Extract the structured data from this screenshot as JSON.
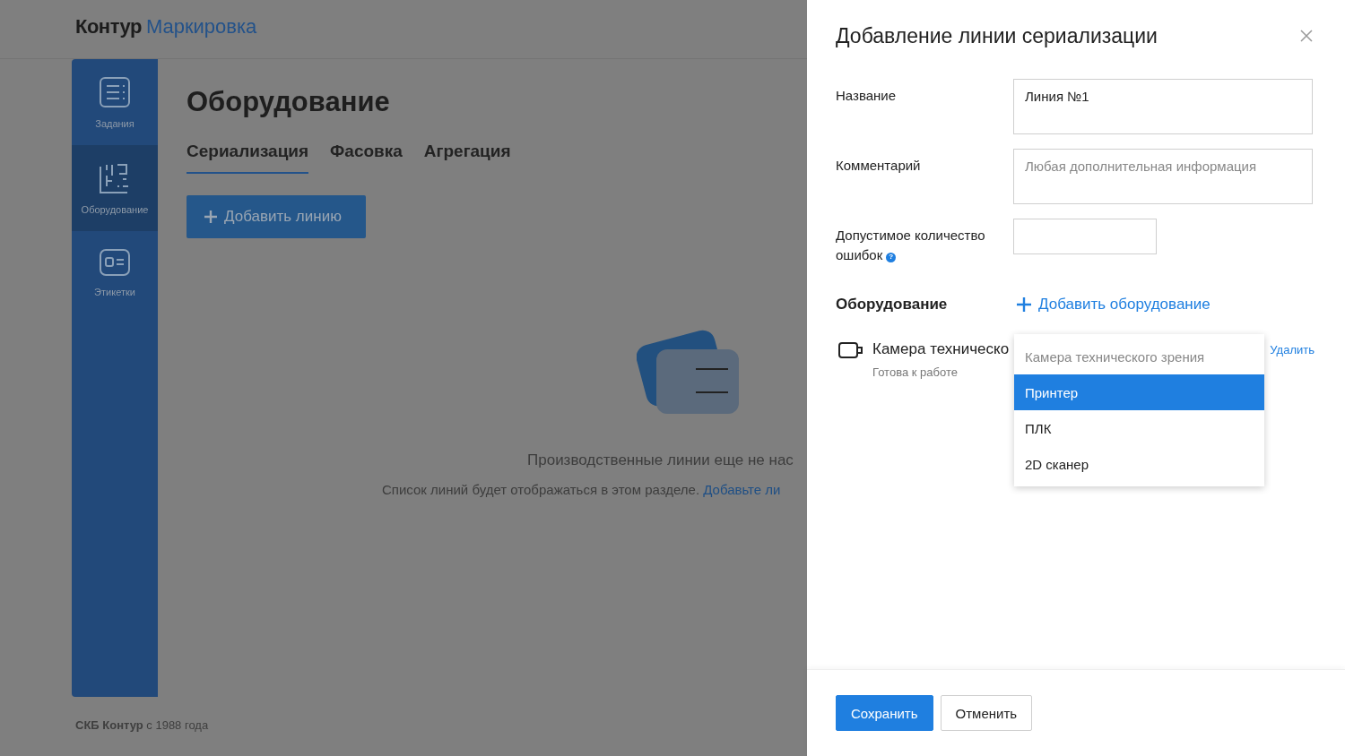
{
  "logo": {
    "brand": "Контур",
    "product": "Маркировка"
  },
  "sidebar": {
    "items": [
      {
        "label": "Задания",
        "kind": "tasks",
        "selected": false
      },
      {
        "label": "Оборудование",
        "kind": "equipment",
        "selected": true
      },
      {
        "label": "Этикетки",
        "kind": "labels",
        "selected": false
      }
    ]
  },
  "page": {
    "title": "Оборудование",
    "tabs": [
      {
        "label": "Сериализация",
        "selected": true
      },
      {
        "label": "Фасовка",
        "selected": false
      },
      {
        "label": "Агрегация",
        "selected": false
      }
    ],
    "add_button": "Добавить линию",
    "empty_state": {
      "heading": "Производственные линии еще не нас",
      "text": "Список линий будет отображаться в этом разделе.",
      "link": "Добавьте ли"
    }
  },
  "footer": "**СКБ Контур** с 1988 года",
  "drawer": {
    "title": "Добавление линии сериализации",
    "fields": [
      {
        "label": "Название",
        "value": "Линия №1",
        "kind": "textarea"
      },
      {
        "label": "Комментарий",
        "placeholder": "Любая дополнительная информация",
        "kind": "textarea"
      },
      {
        "label": "Допустимое количество ошибок",
        "help": "?",
        "kind": "short"
      }
    ],
    "equipment": {
      "label": "Оборудование",
      "add_link": "Добавить оборудование",
      "items": [
        {
          "name": "Камера техническо",
          "status": "Готова к работе",
          "remove": "Удалить"
        }
      ],
      "dropdown": [
        {
          "label": "Камера технического зрения",
          "disabled": true,
          "selected": false
        },
        {
          "label": "Принтер",
          "disabled": false,
          "selected": true
        },
        {
          "label": "ПЛК",
          "disabled": false,
          "selected": false
        },
        {
          "label": "2D сканер",
          "disabled": false,
          "selected": false
        }
      ]
    },
    "buttons": [
      {
        "label": "Сохранить",
        "kind": "primary"
      },
      {
        "label": "Отменить",
        "kind": "secondary"
      }
    ]
  }
}
